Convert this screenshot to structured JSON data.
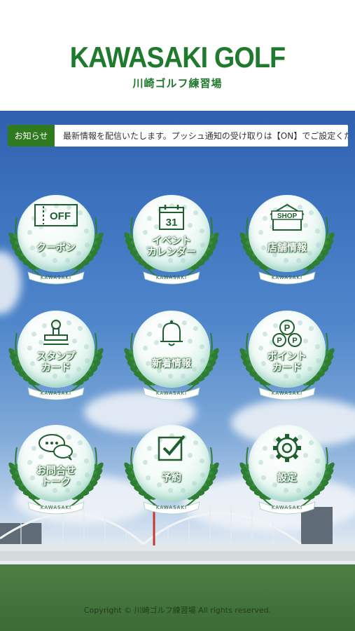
{
  "header": {
    "logo_title": "KAWASAKI GOLF",
    "logo_subtitle": "川崎ゴルフ練習場"
  },
  "notice": {
    "tag": "お知らせ",
    "text": "最新情報を配信いたします。プッシュ通知の受け取りは【ON】でご設定ください。"
  },
  "menu": [
    {
      "label": "クーポン",
      "icon": "coupon-off-icon",
      "icon_text": "OFF"
    },
    {
      "label": "イベント\nカレンダー",
      "icon": "calendar-icon",
      "icon_text": "31"
    },
    {
      "label": "店舗情報",
      "icon": "shop-icon",
      "icon_text": "SHOP"
    },
    {
      "label": "スタンプ\nカード",
      "icon": "stamp-icon"
    },
    {
      "label": "新着情報",
      "icon": "bell-icon"
    },
    {
      "label": "ポイント\nカード",
      "icon": "points-icon",
      "icon_text": "P"
    },
    {
      "label": "お問合せ\nトーク",
      "icon": "chat-icon"
    },
    {
      "label": "予約",
      "icon": "checkbox-icon"
    },
    {
      "label": "設定",
      "icon": "gear-icon"
    }
  ],
  "ribbon_text": "KAWASAKI",
  "footer": {
    "copyright": "Copyright © 川崎ゴルフ練習場 All rights reserved."
  },
  "colors": {
    "brand_green": "#1f7a2e",
    "notice_tag": "#2f7a1e"
  }
}
